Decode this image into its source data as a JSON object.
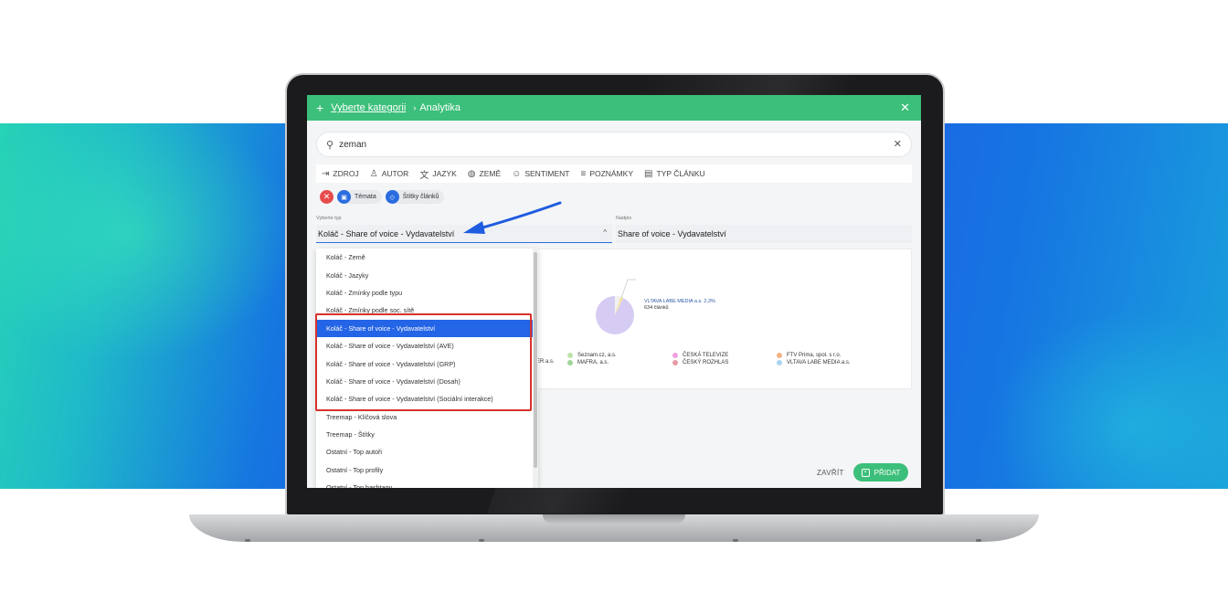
{
  "header": {
    "plus_icon": "plus-icon",
    "category_link": "Vyberte kategorii",
    "separator": "›",
    "title": "Analytika",
    "close_icon": "close-icon"
  },
  "search": {
    "value": "zeman",
    "icon": "search-icon",
    "clear_icon": "clear-icon"
  },
  "filters": [
    {
      "label": "ZDROJ",
      "icon": "source-icon"
    },
    {
      "label": "AUTOR",
      "icon": "author-icon"
    },
    {
      "label": "JAZYK",
      "icon": "language-icon"
    },
    {
      "label": "ZEMĚ",
      "icon": "globe-icon"
    },
    {
      "label": "SENTIMENT",
      "icon": "smiley-icon"
    },
    {
      "label": "POZNÁMKY",
      "icon": "notes-icon"
    },
    {
      "label": "TYP ČLÁNKU",
      "icon": "article-type-icon"
    }
  ],
  "chips": [
    {
      "label": "Témata",
      "icon": "topics-icon"
    },
    {
      "label": "Štítky článků",
      "icon": "tags-icon"
    }
  ],
  "type_select": {
    "label": "Vyberte typ",
    "value": "Koláč - Share of voice - Vydavatelství"
  },
  "heading_field": {
    "label": "Nadpis",
    "value": "Share of voice - Vydavatelství"
  },
  "dropdown": {
    "items": [
      "Koláč - Země",
      "Koláč - Jazyky",
      "Koláč - Zmínky podle typu",
      "Koláč - Zmínky podle soc. sítě",
      "Koláč - Share of voice - Vydavatelství",
      "Koláč - Share of voice - Vydavatelství (AVE)",
      "Koláč - Share of voice - Vydavatelství (GRP)",
      "Koláč - Share of voice - Vydavatelství (Dosah)",
      "Koláč - Share of voice - Vydavatelství (Sociální interakce)",
      "Treemap - Klíčová slova",
      "Treemap - Štítky",
      "Ostatní - Top autoři",
      "Ostatní - Top profily",
      "Ostatní - Top hashtagy"
    ],
    "selected_index": 4
  },
  "preview": {
    "annotation_title": "VLTAVA LABE MEDIA a.s. 2,3%",
    "annotation_sub": "634 článků",
    "cut_label": "ER a.s.",
    "legend": [
      {
        "label": "Seznam.cz, a.s.",
        "color": "#bfe3a8"
      },
      {
        "label": "MAFRA, a.s.",
        "color": "#9fd49a"
      },
      {
        "label": "ČESKÁ TELEVIZE",
        "color": "#ef9fe0"
      },
      {
        "label": "ČESKÝ ROZHLAS",
        "color": "#e89aa6"
      },
      {
        "label": "FTV Prima, spol. s r.o.",
        "color": "#f5b283"
      },
      {
        "label": "VLTAVA LABE MEDIA a.s.",
        "color": "#a9d4f2"
      }
    ],
    "pie_color": "#d6ccf3"
  },
  "footer": {
    "close_label": "ZAVŘÍT",
    "add_label": "PŘIDAT"
  },
  "colors": {
    "accent_green": "#3cbf7a",
    "selected_blue": "#2464e6",
    "highlight_red": "#d9312b"
  }
}
